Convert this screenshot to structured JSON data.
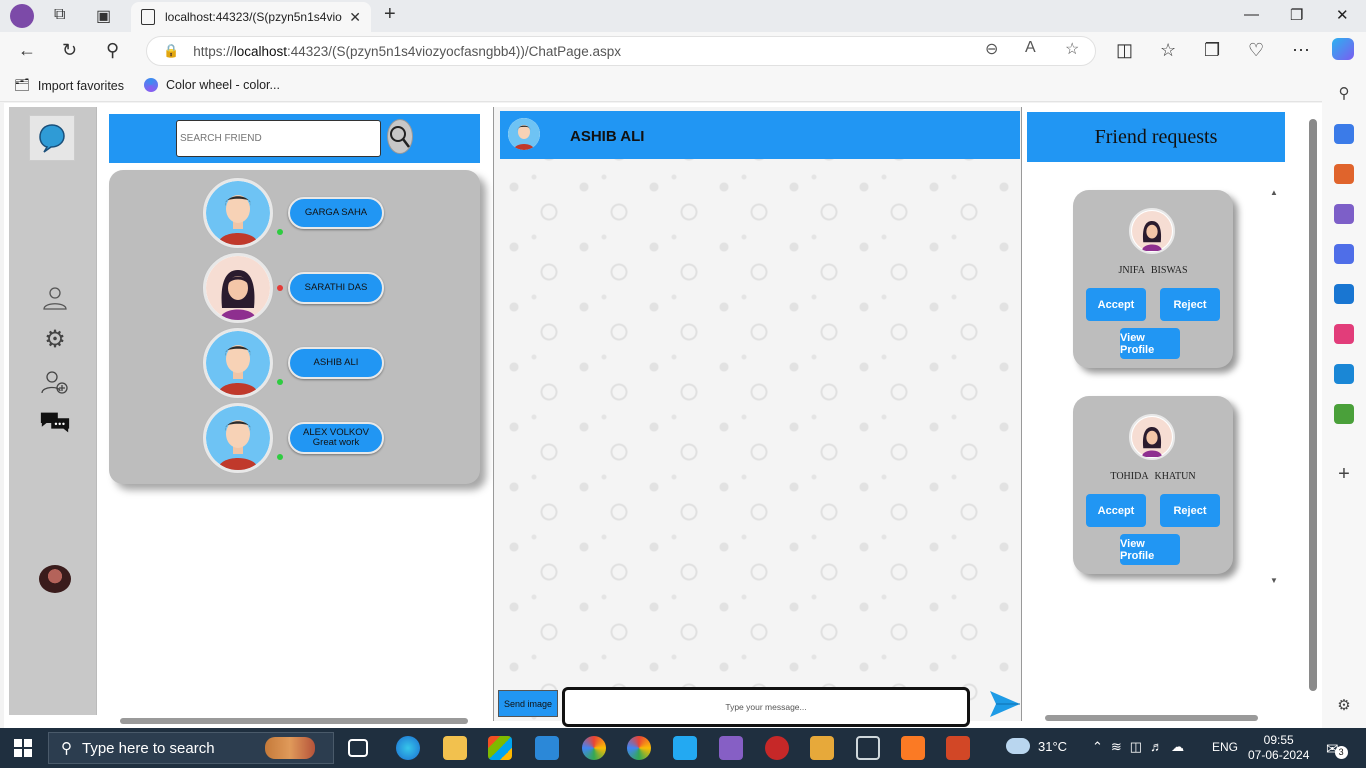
{
  "browser": {
    "tab_title": "localhost:44323/(S(pzyn5n1s4vio",
    "url_prefix": "https://",
    "url_host": "localhost",
    "url_rest": ":44323/(S(pzyn5n1s4viozyocfasngbb4))/ChatPage.aspx",
    "favorites": [
      "Import favorites",
      "Color wheel - color..."
    ]
  },
  "search": {
    "placeholder": "SEARCH FRIEND"
  },
  "friends": [
    {
      "name": "GARGA SAHA",
      "status": "online",
      "last_message": "",
      "status_color": "#2ecc40"
    },
    {
      "name": "SARATHI DAS",
      "status": "offline",
      "last_message": "",
      "status_color": "#e53935"
    },
    {
      "name": "ASHIB ALI",
      "status": "online",
      "last_message": "",
      "status_color": "#2ecc40"
    },
    {
      "name": "ALEX VOLKOV",
      "status": "online",
      "last_message": "Great work",
      "status_color": "#2ecc40"
    }
  ],
  "chat": {
    "contact_name": "ASHIB ALI",
    "send_image_label": "Send image",
    "message_placeholder": "Type your message..."
  },
  "requests": {
    "title": "Friend requests",
    "items": [
      {
        "name": "JNIFA  BISWAS",
        "accept": "Accept",
        "reject": "Reject",
        "view": "View Profile"
      },
      {
        "name": "TOHIDA  KHATUN",
        "accept": "Accept",
        "reject": "Reject",
        "view": "View Profile"
      }
    ]
  },
  "taskbar": {
    "search_text": "Type here to search",
    "weather": "31°C",
    "language": "ENG",
    "time": "09:55",
    "date": "07-06-2024",
    "notifications": "3"
  },
  "colors": {
    "accent": "#2196f3",
    "panel_grey": "#bdbdbd",
    "nav_grey": "#c8c8c8"
  }
}
